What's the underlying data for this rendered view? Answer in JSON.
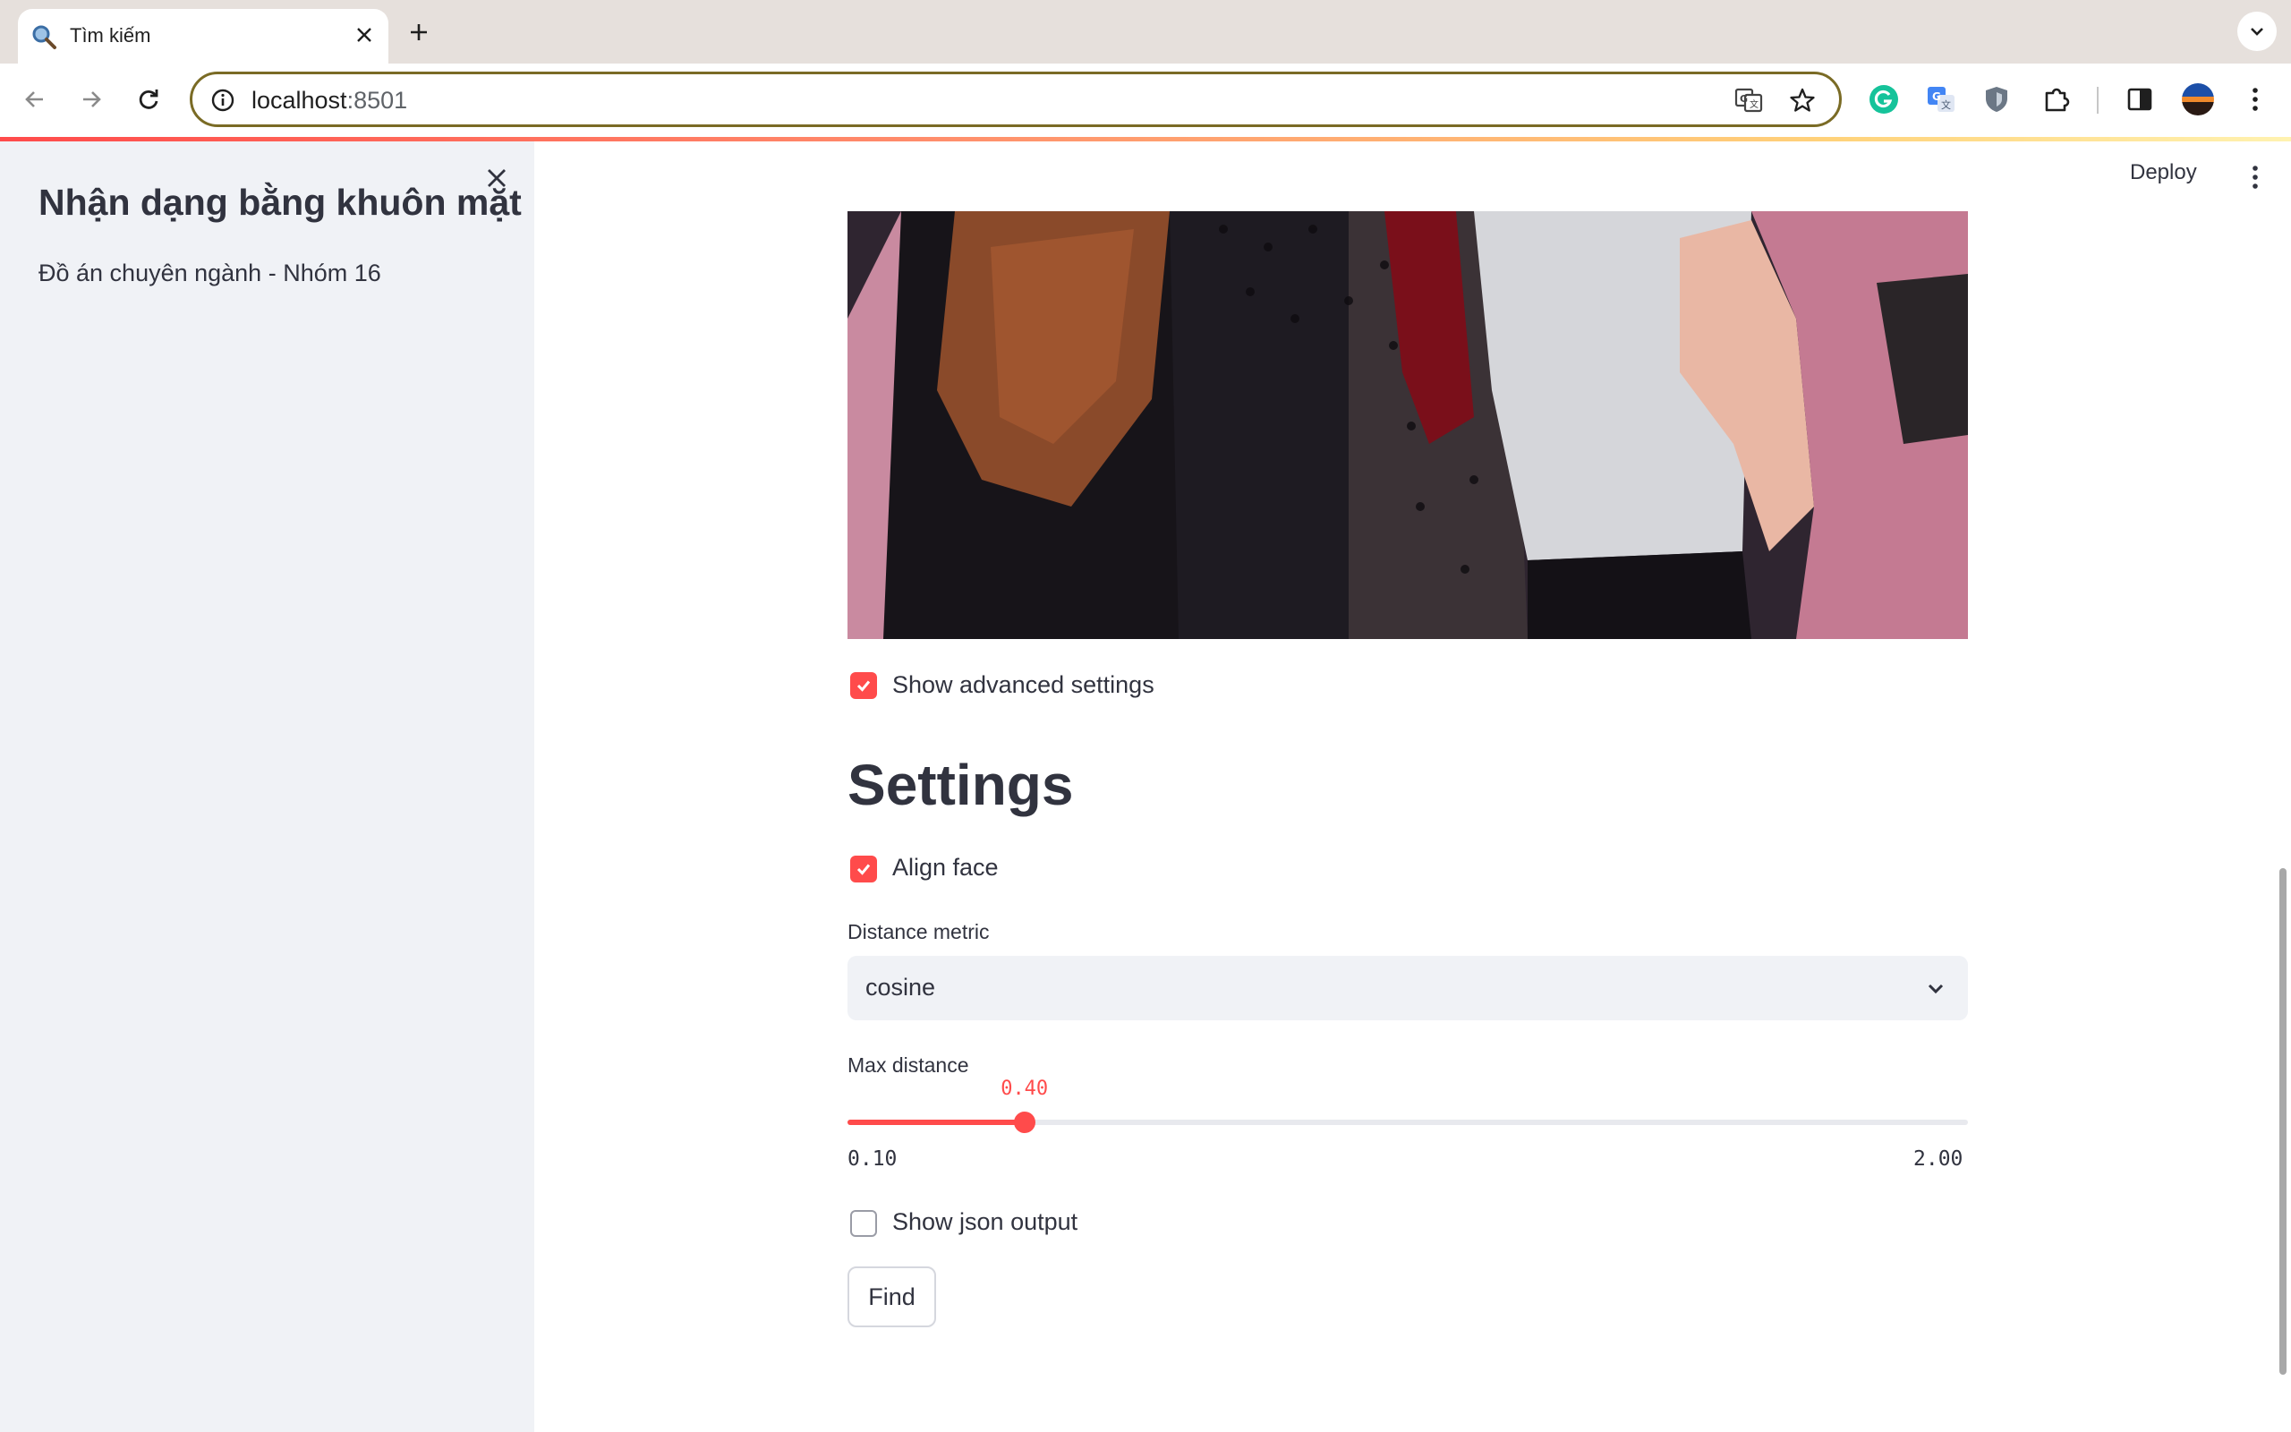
{
  "browser": {
    "tab_title": "Tìm kiếm",
    "url_host": "localhost",
    "url_port": ":8501",
    "icons": [
      "search-icon",
      "close-icon",
      "plus-icon",
      "chevron-down-icon",
      "back-icon",
      "forward-icon",
      "reload-icon",
      "info-icon",
      "translate-icon",
      "star-icon",
      "grammarly-icon",
      "google-translate-icon",
      "shield-icon",
      "puzzle-icon",
      "side-panel-icon",
      "avatar",
      "kebab-icon"
    ]
  },
  "sidebar": {
    "title": "Nhận dạng bằng khuôn mặt",
    "subtitle": "Đồ án chuyên ngành - Nhóm 16"
  },
  "header": {
    "deploy_label": "Deploy"
  },
  "main": {
    "show_advanced_label": "Show advanced settings",
    "show_advanced_checked": true,
    "settings_heading": "Settings",
    "align_face_label": "Align face",
    "align_face_checked": true,
    "distance_metric_label": "Distance metric",
    "distance_metric_value": "cosine",
    "max_distance_label": "Max distance",
    "max_distance_value": "0.40",
    "max_distance_min": "0.10",
    "max_distance_max": "2.00",
    "max_distance_fraction": 0.1579,
    "show_json_label": "Show json output",
    "show_json_checked": false,
    "find_label": "Find"
  },
  "colors": {
    "accent": "#ff4b4b",
    "sidebar_bg": "#f0f2f6",
    "text": "#31333f"
  }
}
